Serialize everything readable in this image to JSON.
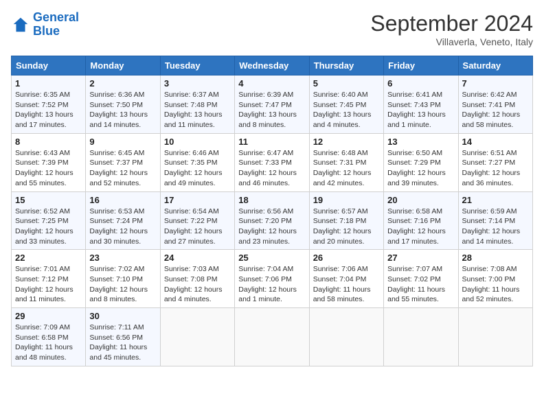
{
  "header": {
    "logo_line1": "General",
    "logo_line2": "Blue",
    "month": "September 2024",
    "location": "Villaverla, Veneto, Italy"
  },
  "weekdays": [
    "Sunday",
    "Monday",
    "Tuesday",
    "Wednesday",
    "Thursday",
    "Friday",
    "Saturday"
  ],
  "weeks": [
    [
      {
        "day": "1",
        "info": "Sunrise: 6:35 AM\nSunset: 7:52 PM\nDaylight: 13 hours\nand 17 minutes."
      },
      {
        "day": "2",
        "info": "Sunrise: 6:36 AM\nSunset: 7:50 PM\nDaylight: 13 hours\nand 14 minutes."
      },
      {
        "day": "3",
        "info": "Sunrise: 6:37 AM\nSunset: 7:48 PM\nDaylight: 13 hours\nand 11 minutes."
      },
      {
        "day": "4",
        "info": "Sunrise: 6:39 AM\nSunset: 7:47 PM\nDaylight: 13 hours\nand 8 minutes."
      },
      {
        "day": "5",
        "info": "Sunrise: 6:40 AM\nSunset: 7:45 PM\nDaylight: 13 hours\nand 4 minutes."
      },
      {
        "day": "6",
        "info": "Sunrise: 6:41 AM\nSunset: 7:43 PM\nDaylight: 13 hours\nand 1 minute."
      },
      {
        "day": "7",
        "info": "Sunrise: 6:42 AM\nSunset: 7:41 PM\nDaylight: 12 hours\nand 58 minutes."
      }
    ],
    [
      {
        "day": "8",
        "info": "Sunrise: 6:43 AM\nSunset: 7:39 PM\nDaylight: 12 hours\nand 55 minutes."
      },
      {
        "day": "9",
        "info": "Sunrise: 6:45 AM\nSunset: 7:37 PM\nDaylight: 12 hours\nand 52 minutes."
      },
      {
        "day": "10",
        "info": "Sunrise: 6:46 AM\nSunset: 7:35 PM\nDaylight: 12 hours\nand 49 minutes."
      },
      {
        "day": "11",
        "info": "Sunrise: 6:47 AM\nSunset: 7:33 PM\nDaylight: 12 hours\nand 46 minutes."
      },
      {
        "day": "12",
        "info": "Sunrise: 6:48 AM\nSunset: 7:31 PM\nDaylight: 12 hours\nand 42 minutes."
      },
      {
        "day": "13",
        "info": "Sunrise: 6:50 AM\nSunset: 7:29 PM\nDaylight: 12 hours\nand 39 minutes."
      },
      {
        "day": "14",
        "info": "Sunrise: 6:51 AM\nSunset: 7:27 PM\nDaylight: 12 hours\nand 36 minutes."
      }
    ],
    [
      {
        "day": "15",
        "info": "Sunrise: 6:52 AM\nSunset: 7:25 PM\nDaylight: 12 hours\nand 33 minutes."
      },
      {
        "day": "16",
        "info": "Sunrise: 6:53 AM\nSunset: 7:24 PM\nDaylight: 12 hours\nand 30 minutes."
      },
      {
        "day": "17",
        "info": "Sunrise: 6:54 AM\nSunset: 7:22 PM\nDaylight: 12 hours\nand 27 minutes."
      },
      {
        "day": "18",
        "info": "Sunrise: 6:56 AM\nSunset: 7:20 PM\nDaylight: 12 hours\nand 23 minutes."
      },
      {
        "day": "19",
        "info": "Sunrise: 6:57 AM\nSunset: 7:18 PM\nDaylight: 12 hours\nand 20 minutes."
      },
      {
        "day": "20",
        "info": "Sunrise: 6:58 AM\nSunset: 7:16 PM\nDaylight: 12 hours\nand 17 minutes."
      },
      {
        "day": "21",
        "info": "Sunrise: 6:59 AM\nSunset: 7:14 PM\nDaylight: 12 hours\nand 14 minutes."
      }
    ],
    [
      {
        "day": "22",
        "info": "Sunrise: 7:01 AM\nSunset: 7:12 PM\nDaylight: 12 hours\nand 11 minutes."
      },
      {
        "day": "23",
        "info": "Sunrise: 7:02 AM\nSunset: 7:10 PM\nDaylight: 12 hours\nand 8 minutes."
      },
      {
        "day": "24",
        "info": "Sunrise: 7:03 AM\nSunset: 7:08 PM\nDaylight: 12 hours\nand 4 minutes."
      },
      {
        "day": "25",
        "info": "Sunrise: 7:04 AM\nSunset: 7:06 PM\nDaylight: 12 hours\nand 1 minute."
      },
      {
        "day": "26",
        "info": "Sunrise: 7:06 AM\nSunset: 7:04 PM\nDaylight: 11 hours\nand 58 minutes."
      },
      {
        "day": "27",
        "info": "Sunrise: 7:07 AM\nSunset: 7:02 PM\nDaylight: 11 hours\nand 55 minutes."
      },
      {
        "day": "28",
        "info": "Sunrise: 7:08 AM\nSunset: 7:00 PM\nDaylight: 11 hours\nand 52 minutes."
      }
    ],
    [
      {
        "day": "29",
        "info": "Sunrise: 7:09 AM\nSunset: 6:58 PM\nDaylight: 11 hours\nand 48 minutes."
      },
      {
        "day": "30",
        "info": "Sunrise: 7:11 AM\nSunset: 6:56 PM\nDaylight: 11 hours\nand 45 minutes."
      },
      {
        "day": "",
        "info": ""
      },
      {
        "day": "",
        "info": ""
      },
      {
        "day": "",
        "info": ""
      },
      {
        "day": "",
        "info": ""
      },
      {
        "day": "",
        "info": ""
      }
    ]
  ]
}
